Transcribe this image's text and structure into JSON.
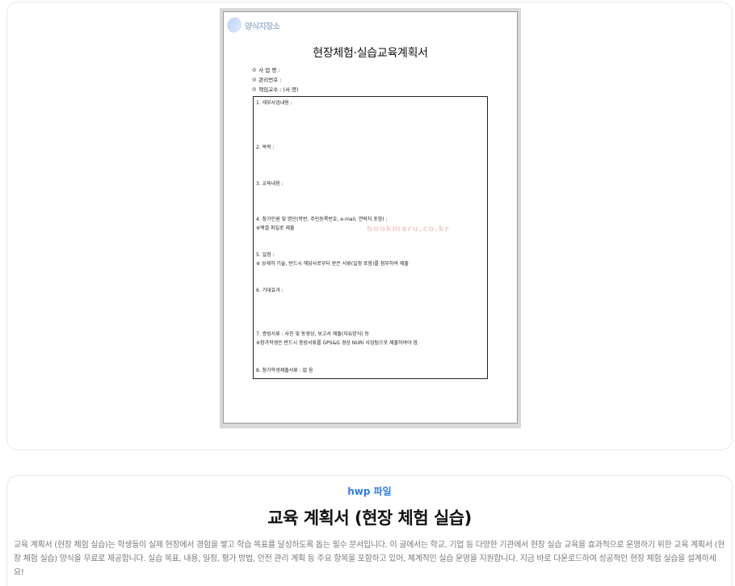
{
  "preview": {
    "logo_text": "양식지장소",
    "watermark_text": "bookmaru.co.kr",
    "doc_title": "현장체험·실습교육계획서",
    "meta": [
      {
        "bullet": "◎",
        "label": "사 업 명 :"
      },
      {
        "bullet": "◎",
        "label": "관리번호 :"
      },
      {
        "bullet": "◎",
        "label": "책임교수 :                    (서  명)"
      }
    ],
    "items": [
      {
        "text": "1. 세부사업내용 :"
      },
      {
        "text": "2. 목적 :"
      },
      {
        "text": "3. 교육내용 :"
      },
      {
        "text": "4. 참가인원 및 명단(학번, 주민등록번호, e-mail, 연락처 포함) :"
      },
      {
        "text": "※엑셀 파일로 제출"
      },
      {
        "text": "5. 일정 :"
      },
      {
        "text": "※ 상세히 기술, 반드시 해당사로부터 받은 서류(일정 포함)를 첨부하여 제출"
      },
      {
        "text": "6. 기대효과 :"
      },
      {
        "text": "7. 증빙서류 : 사진 및 동영상, 보고서 제출(자유양식) 등"
      },
      {
        "text": "※참가학생은 반드시 증빙서류를 GPS&G 경상 NURI 사업팀으로 제출하여야 함."
      },
      {
        "text": "8. 참가학생제출서류 : 없 음"
      }
    ]
  },
  "info": {
    "file_type": "hwp 파일",
    "title": "교육 계획서 (현장 체험 실습)",
    "description": "교육 계획서 (현장 체험 실습)는 학생들이 실제 현장에서 경험을 쌓고 학습 목표를 달성하도록 돕는 필수 문서입니다. 이 글에서는 학교, 기업 등 다양한 기관에서 현장 실습 교육을 효과적으로 운영하기 위한 교육 계획서 (현장 체험 실습) 양식을 무료로 제공합니다. 실습 목표, 내용, 일정, 평가 방법, 안전 관리 계획 등 주요 항목을 포함하고 있어, 체계적인 실습 운영을 지원합니다. 지금 바로 다운로드하여 성공적인 현장 체험 실습을 설계하세요!"
  }
}
